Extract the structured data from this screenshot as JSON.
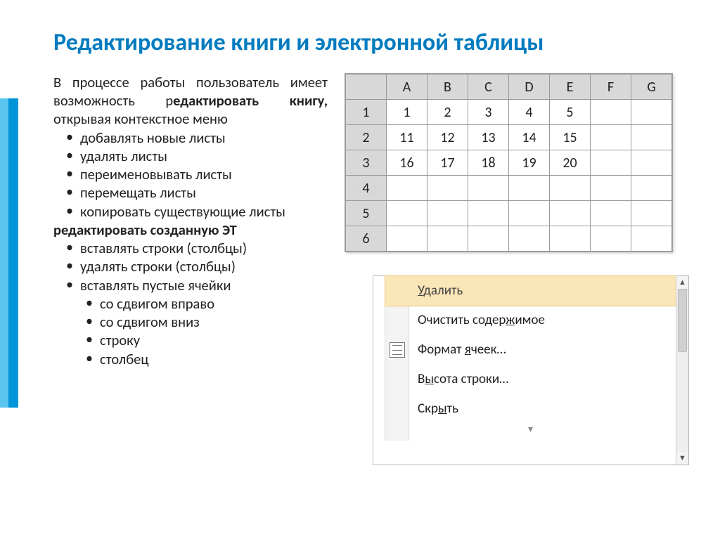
{
  "title": "Редактирование книги и электронной таблицы",
  "para": {
    "line1a": "В процессе работы пользователь имеет возможность р",
    "line1b": "едактировать книгу,",
    "line1c": " открывая контекстное меню"
  },
  "list1": {
    "i0": "добавлять новые листы",
    "i1": "удалять листы",
    "i2": "переименовывать листы",
    "i3": "перемещать листы",
    "i4": "копировать существующие листы"
  },
  "para2": "редактировать созданную ЭТ",
  "list2": {
    "i0": "вставлять строки (столбцы)",
    "i1": "удалять строки (столбцы)",
    "i2": "вставлять пустые ячейки"
  },
  "list3": {
    "i0": "со сдвигом вправо",
    "i1": "со сдвигом вниз",
    "i2": "строку",
    "i3": "столбец"
  },
  "sheet": {
    "cols": {
      "c0": "A",
      "c1": "B",
      "c2": "C",
      "c3": "D",
      "c4": "E",
      "c5": "F",
      "c6": "G"
    },
    "rows": {
      "r0": "1",
      "r1": "2",
      "r2": "3",
      "r3": "4",
      "r4": "5",
      "r5": "6"
    },
    "data": {
      "r0": {
        "c0": "1",
        "c1": "2",
        "c2": "3",
        "c3": "4",
        "c4": "5",
        "c5": "",
        "c6": ""
      },
      "r1": {
        "c0": "11",
        "c1": "12",
        "c2": "13",
        "c3": "14",
        "c4": "15",
        "c5": "",
        "c6": ""
      },
      "r2": {
        "c0": "16",
        "c1": "17",
        "c2": "18",
        "c3": "19",
        "c4": "20",
        "c5": "",
        "c6": ""
      },
      "r3": {
        "c0": "",
        "c1": "",
        "c2": "",
        "c3": "",
        "c4": "",
        "c5": "",
        "c6": ""
      },
      "r4": {
        "c0": "",
        "c1": "",
        "c2": "",
        "c3": "",
        "c4": "",
        "c5": "",
        "c6": ""
      },
      "r5": {
        "c0": "",
        "c1": "",
        "c2": "",
        "c3": "",
        "c4": "",
        "c5": "",
        "c6": ""
      }
    }
  },
  "menu": {
    "delete_pre": "",
    "delete_u": "У",
    "delete_post": "далить",
    "clear_pre": "Очистить содер",
    "clear_u": "ж",
    "clear_post": "имое",
    "format_pre": "Формат ",
    "format_u": "я",
    "format_post": "чеек…",
    "height_pre": "В",
    "height_u": "ы",
    "height_post": "сота строки…",
    "hide_pre": "Скр",
    "hide_u": "ы",
    "hide_post": "ть",
    "more": "▾"
  }
}
